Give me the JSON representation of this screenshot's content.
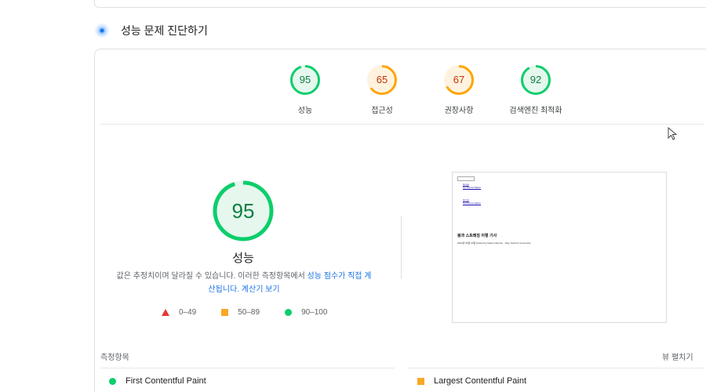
{
  "section": {
    "title": "성능 문제 진단하기"
  },
  "categories": [
    {
      "score": 95,
      "label": "성능",
      "color": "#0cce6b",
      "text_color": "#0b8043",
      "fill": "#e6f7ee"
    },
    {
      "score": 65,
      "label": "접근성",
      "color": "#ffa400",
      "text_color": "#c33300",
      "fill": "#fff3e0"
    },
    {
      "score": 67,
      "label": "권장사항",
      "color": "#ffa400",
      "text_color": "#c33300",
      "fill": "#fff3e0"
    },
    {
      "score": 92,
      "label": "검색엔진 최적화",
      "color": "#0cce6b",
      "text_color": "#0b8043",
      "fill": "#e6f7ee"
    }
  ],
  "performance": {
    "score": 95,
    "label": "성능",
    "desc_text": "값은 추정치이며 달라질 수 있습니다. 이러한 측정항목에서 ",
    "desc_link": "성능 점수가 직접 계산됩니다.",
    "calc_link": "계산기 보기"
  },
  "legend": {
    "poor": "0–49",
    "average": "50–89",
    "good": "90–100"
  },
  "thumbnail": {
    "links_top": [
      "Home",
      "Go Future Nation"
    ],
    "links_mid": [
      "Home",
      "Go Future Nation"
    ],
    "heading": "봉과 스트레칭 이렇 기사",
    "meta": "2023년 09월 24일 Posted by Nelson Ronnie · Stay Tooll No Comments"
  },
  "metrics": {
    "title": "측정항목",
    "expand": "뷰 펼치기",
    "items": [
      {
        "label": "First Contentful Paint",
        "status": "good"
      },
      {
        "label": "Largest Contentful Paint",
        "status": "average"
      }
    ]
  },
  "colors": {
    "good": "#0cce6b",
    "average": "#ffa400",
    "poor": "#e53935",
    "link": "#1a73e8"
  }
}
